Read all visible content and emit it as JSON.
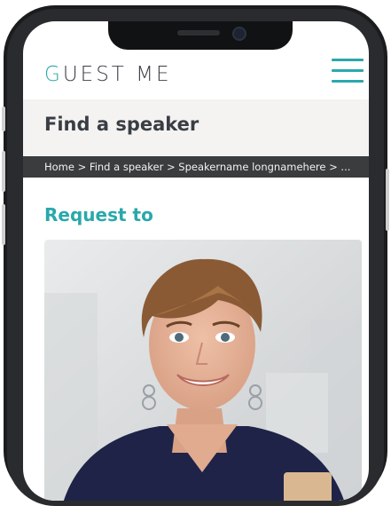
{
  "brand": {
    "logo_first": "G",
    "logo_rest": "UEST ME",
    "accent": "#2aa8ab"
  },
  "header": {
    "menu_icon": "hamburger-menu-icon"
  },
  "page": {
    "title": "Find a speaker"
  },
  "breadcrumb": {
    "items": [
      "Home",
      "Find a speaker",
      "Speakername longnamehere",
      "..."
    ],
    "separator": ">"
  },
  "section": {
    "heading": "Request to"
  },
  "photo": {
    "subject": "speaker-portrait"
  }
}
